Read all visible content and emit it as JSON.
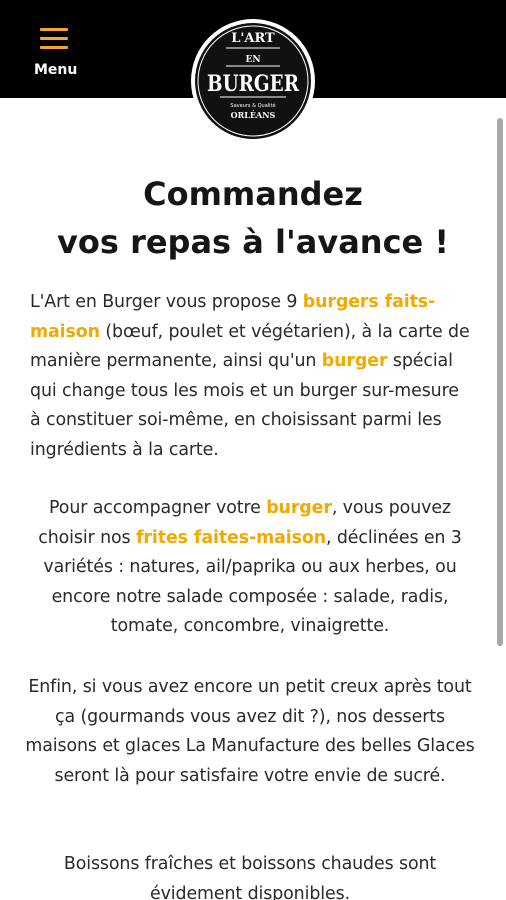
{
  "header": {
    "menu_label": "Menu",
    "logo": {
      "line1": "L'ART",
      "line2": "EN",
      "line3": "BURGER",
      "tagline": "Saveurs & Qualité",
      "city": "ORLÉANS"
    }
  },
  "main": {
    "title_line1": "Commandez",
    "title_line2": "vos repas à l'avance !",
    "paragraphs": [
      [
        {
          "text": "L'Art en Burger vous propose 9 ",
          "hl": false
        },
        {
          "text": "burgers faits-maison",
          "hl": true
        },
        {
          "text": " (bœuf, poulet et végétarien), à la carte de manière permanente, ainsi qu'un ",
          "hl": false
        },
        {
          "text": "burger",
          "hl": true
        },
        {
          "text": " spécial qui change tous les mois et un burger sur-mesure à constituer soi-même, en choisissant parmi les ingrédients à la carte.",
          "hl": false
        }
      ],
      [
        {
          "text": "Pour accompagner votre ",
          "hl": false
        },
        {
          "text": "burger",
          "hl": true
        },
        {
          "text": ", vous pouvez choisir nos ",
          "hl": false
        },
        {
          "text": "frites faites-maison",
          "hl": true
        },
        {
          "text": ", déclinées en 3 variétés : natures, ail/paprika ou aux herbes, ou encore notre salade composée : salade, radis, tomate, concombre, vinaigrette.",
          "hl": false
        }
      ],
      [
        {
          "text": "Enfin, si vous avez encore un petit creux après tout ça (gourmands vous avez dit ?), nos desserts maisons et glaces La Manufacture des belles Glaces seront là pour satisfaire votre envie de sucré.",
          "hl": false
        }
      ],
      [
        {
          "text": "Boissons fraîches et boissons chaudes sont évidement disponibles.",
          "hl": false
        }
      ]
    ]
  },
  "colors": {
    "accent": "#f2a900",
    "header_bg": "#000000",
    "text": "#2a2a2a"
  }
}
